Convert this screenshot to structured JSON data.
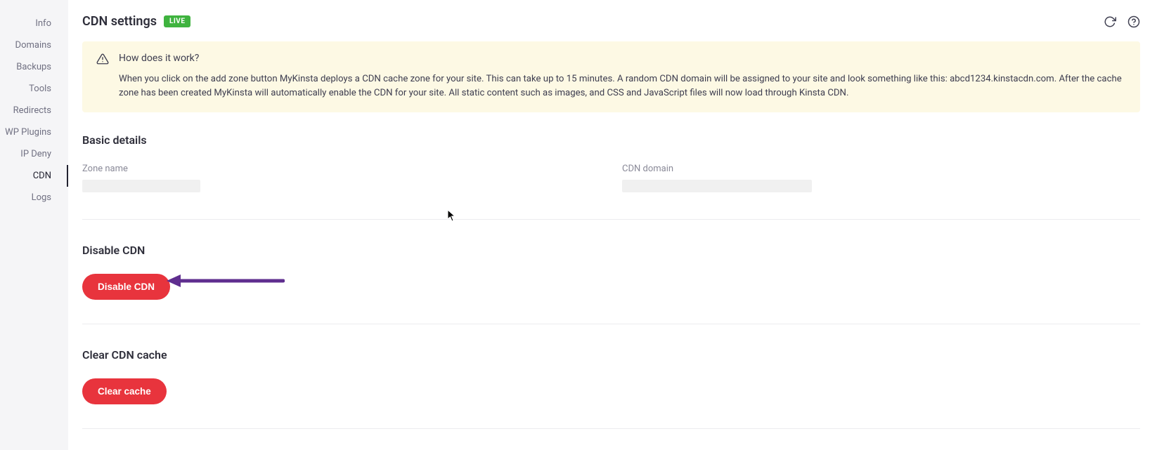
{
  "sidebar": {
    "items": [
      {
        "label": "Info"
      },
      {
        "label": "Domains"
      },
      {
        "label": "Backups"
      },
      {
        "label": "Tools"
      },
      {
        "label": "Redirects"
      },
      {
        "label": "WP Plugins"
      },
      {
        "label": "IP Deny"
      },
      {
        "label": "CDN"
      },
      {
        "label": "Logs"
      }
    ],
    "activeIndex": 7
  },
  "header": {
    "title": "CDN settings",
    "badge": {
      "text": "LIVE",
      "color": "#3fb33f"
    }
  },
  "notice": {
    "title": "How does it work?",
    "text": "When you click on the add zone button MyKinsta deploys a CDN cache zone for your site. This can take up to 15 minutes. A random CDN domain will be assigned to your site and look something like this: abcd1234.kinstacdn.com. After the cache zone has been created MyKinsta will automatically enable the CDN for your site. All static content such as images, and CSS and JavaScript files will now load through Kinsta CDN."
  },
  "sections": {
    "basic": {
      "title": "Basic details",
      "zoneLabel": "Zone name",
      "zoneValue": "",
      "domainLabel": "CDN domain",
      "domainValue": ""
    },
    "disable": {
      "title": "Disable CDN",
      "button": "Disable CDN"
    },
    "clear": {
      "title": "Clear CDN cache",
      "button": "Clear cache"
    }
  },
  "annotation": {
    "arrowColor": "#5f2e8f"
  }
}
